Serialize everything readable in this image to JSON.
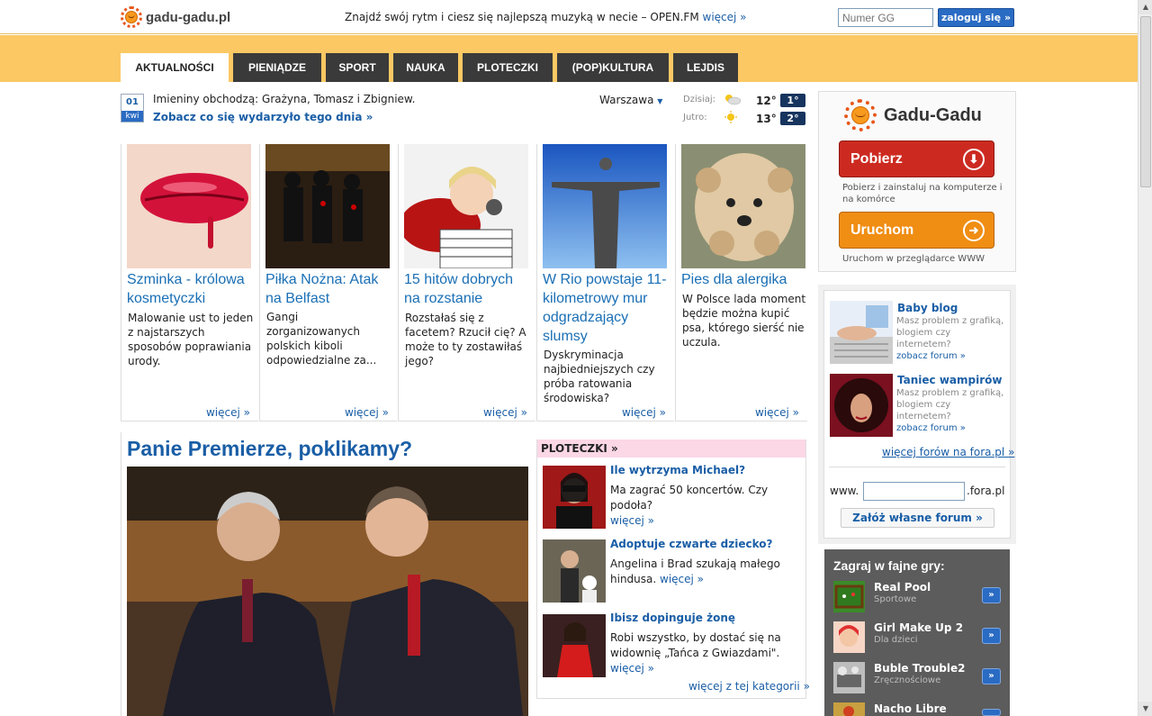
{
  "header": {
    "logo_text": "gadu-gadu.pl",
    "promo_text": "Znajdź swój rytm i ciesz się najlepszą muzyką w necie – OPEN.FM",
    "promo_link": "więcej »",
    "gg_placeholder": "Numer GG",
    "login_label": "zaloguj się »"
  },
  "tabs": [
    {
      "label": "AKTUALNOŚCI"
    },
    {
      "label": "PIENIĄDZE"
    },
    {
      "label": "SPORT"
    },
    {
      "label": "NAUKA"
    },
    {
      "label": "PLOTECZKI"
    },
    {
      "label": "(POP)KULTURA"
    },
    {
      "label": "LEJDIS"
    }
  ],
  "info": {
    "cal_day": "01",
    "cal_month": "kwi",
    "namedays": "Imieniny obchodzą: Grażyna, Tomasz i Zbigniew.",
    "day_link": "Zobacz co się wydarzyło tego dnia »",
    "city": "Warszawa",
    "today_label": "Dzisiaj:",
    "today_temp": "12°",
    "today_badge": "1°",
    "tomorrow_label": "Jutro:",
    "tomorrow_temp": "13°",
    "tomorrow_badge": "2°"
  },
  "cards": [
    {
      "title": "Szminka - królowa kosmetyczki",
      "desc": "Malowanie ust to jeden z najstarszych sposobów poprawiania urody.",
      "more": "więcej »"
    },
    {
      "title": "Piłka Nożna: Atak na Belfast",
      "desc": "Gangi zorganizowanych polskich kiboli odpowiedzialne za...",
      "more": "więcej »"
    },
    {
      "title": "15 hitów dobrych na rozstanie",
      "desc": "Rozstałaś się z facetem? Rzucił cię? A może to ty zostawiłaś jego?",
      "more": "więcej »"
    },
    {
      "title": "W Rio powstaje 11-kilometrowy mur odgradzający slumsy",
      "desc": "Dyskryminacja najbiedniejszych czy próba ratowania środowiska?",
      "more": "więcej »"
    },
    {
      "title": "Pies dla alergika",
      "desc": "W Polsce lada moment będzie można kupić psa, którego sierść nie uczula.",
      "more": "więcej »"
    }
  ],
  "main_story": {
    "title": "Panie Premierze, poklikamy?"
  },
  "gossip": {
    "header": "PLOTECZKI »",
    "items": [
      {
        "title": "Ile wytrzyma Michael?",
        "desc": "Ma zagrać 50 koncertów. Czy podoła?",
        "more": "więcej »"
      },
      {
        "title": "Adoptuje czwarte dziecko?",
        "desc": "Angelina i Brad szukają małego hindusa.",
        "more": "więcej »"
      },
      {
        "title": "Ibisz dopinguje żonę",
        "desc": "Robi wszystko, by dostać się na widownię „Tańca z Gwiazdami\".",
        "more": "więcej »"
      }
    ],
    "category_more": "więcej z tej kategorii »"
  },
  "app_box": {
    "title": "Gadu-Gadu",
    "download_label": "Pobierz",
    "download_note": "Pobierz i zainstaluj na komputerze i na komórce",
    "run_label": "Uruchom",
    "run_note": "Uruchom w przeglądarce WWW"
  },
  "forums": {
    "items": [
      {
        "title": "Baby blog",
        "desc": "Masz problem z grafiką, blogiem czy internetem?",
        "link": "zobacz forum »"
      },
      {
        "title": "Taniec wampirów",
        "desc": "Masz problem z grafiką, blogiem czy internetem?",
        "link": "zobacz forum »"
      }
    ],
    "more": "więcej forów na fora.pl »",
    "www_label": "www.",
    "suffix": ".fora.pl",
    "create_label": "Załóż własne forum »"
  },
  "games": {
    "title": "Zagraj w fajne gry:",
    "items": [
      {
        "name": "Real Pool",
        "category": "Sportowe"
      },
      {
        "name": "Girl Make Up 2",
        "category": "Dla dzieci"
      },
      {
        "name": "Buble Trouble2",
        "category": "Zręcznościowe"
      },
      {
        "name": "Nacho Libre",
        "category": ""
      }
    ],
    "button": "»"
  },
  "colors": {
    "accent": "#1a5ea6",
    "nav_band": "#fbc863",
    "tab_dark": "#3a3a3a",
    "gossip_pink": "#fcd7e6"
  }
}
